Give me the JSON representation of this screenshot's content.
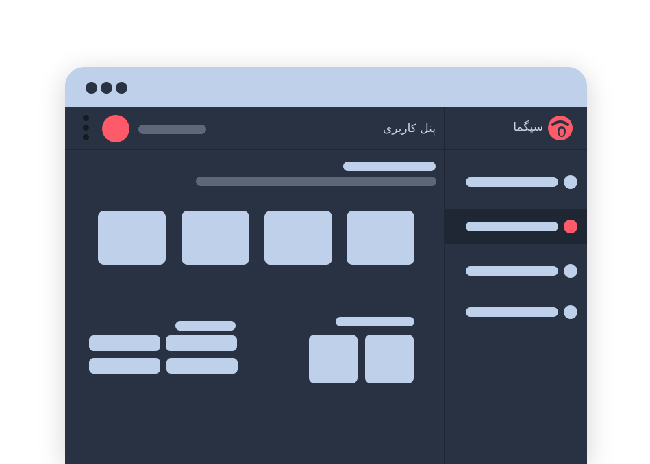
{
  "window": {
    "titlebar_controls": [
      "close-dot",
      "minimize-dot",
      "maximize-dot"
    ]
  },
  "sidebar": {
    "brand_name": "سیگما",
    "items": [
      {
        "label": "",
        "active": false
      },
      {
        "label": "",
        "active": true
      },
      {
        "label": "",
        "active": false
      },
      {
        "label": "",
        "active": false
      }
    ]
  },
  "topbar": {
    "title": "پنل کاربری",
    "user_name": ""
  },
  "colors": {
    "titlebar": "#bfd0ea",
    "background": "#293242",
    "placeholder": "#bfd0ea",
    "accent": "#ff5a6a",
    "muted": "#5d6778"
  }
}
